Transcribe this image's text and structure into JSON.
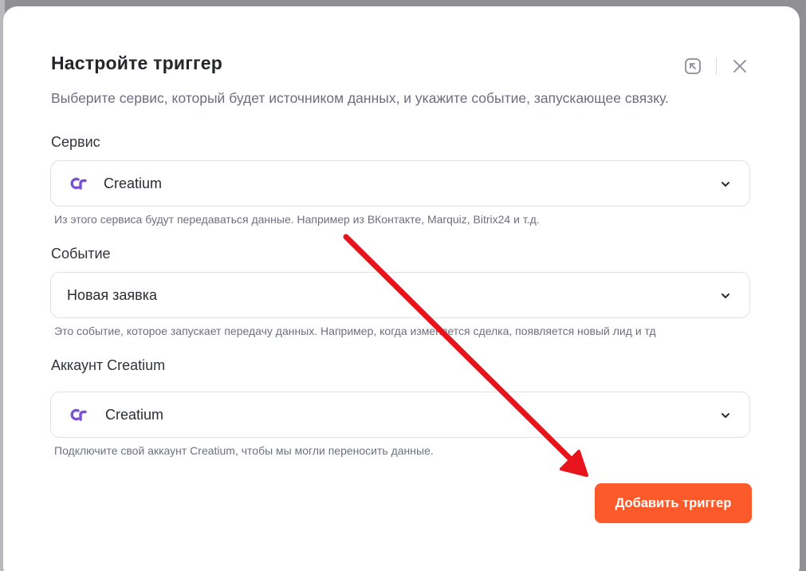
{
  "modal": {
    "title": "Настройте триггер",
    "subtitle": "Выберите сервис, который будет источником данных, и укажите событие, запускающее связку.",
    "actions": {
      "expand_icon": "expand-arrow-icon",
      "close_icon": "close-icon"
    }
  },
  "fields": {
    "service": {
      "label": "Сервис",
      "value": "Creatium",
      "logo": "creatium-logo",
      "hint": "Из этого сервиса будут передаваться данные. Например из ВКонтакте, Marquiz, Bitrix24 и т.д."
    },
    "event": {
      "label": "Событие",
      "value": "Новая заявка",
      "hint": "Это событие, которое запускает передачу данных. Например, когда изменяется сделка, появляется новый лид и тд"
    },
    "account": {
      "label": "Аккаунт Creatium",
      "value": "Creatium",
      "logo": "creatium-logo",
      "hint": "Подключите свой аккаунт Creatium, чтобы мы могли переносить данные."
    }
  },
  "footer": {
    "submit_label": "Добавить триггер"
  },
  "colors": {
    "accent": "#fd5a2b",
    "logo": "#7b4fd6",
    "annotation_arrow": "#e8141c",
    "overlay": "#8f8f94"
  }
}
